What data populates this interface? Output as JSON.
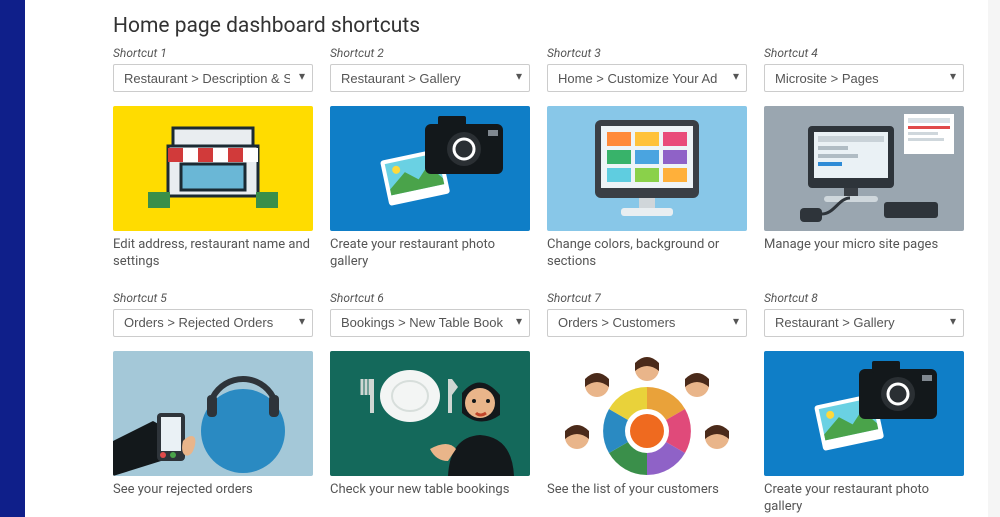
{
  "title": "Home page dashboard shortcuts",
  "shortcuts": [
    {
      "label": "Shortcut 1",
      "value": "Restaurant > Description & S",
      "caption": "Edit address, restaurant name and settings"
    },
    {
      "label": "Shortcut 2",
      "value": "Restaurant > Gallery",
      "caption": "Create your restaurant photo gallery"
    },
    {
      "label": "Shortcut 3",
      "value": "Home > Customize Your Ad",
      "caption": "Change colors, background or sections"
    },
    {
      "label": "Shortcut 4",
      "value": "Microsite > Pages",
      "caption": "Manage your micro site pages"
    },
    {
      "label": "Shortcut 5",
      "value": "Orders > Rejected Orders",
      "caption": "See your rejected orders"
    },
    {
      "label": "Shortcut 6",
      "value": "Bookings > New Table Book",
      "caption": "Check your new table bookings"
    },
    {
      "label": "Shortcut 7",
      "value": "Orders > Customers",
      "caption": "See the list of your customers"
    },
    {
      "label": "Shortcut 8",
      "value": "Restaurant > Gallery",
      "caption": "Create your restaurant photo gallery"
    }
  ]
}
